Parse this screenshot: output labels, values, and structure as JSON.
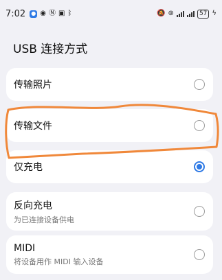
{
  "status_bar": {
    "time": "7:02",
    "battery": "57",
    "icons": [
      "app-icon",
      "eye-icon",
      "nfc-icon",
      "gallery-icon",
      "bluetooth-icon",
      "mute-icon",
      "hotspot-icon",
      "signal-icon",
      "signal-icon",
      "battery-icon",
      "charging-icon"
    ]
  },
  "page": {
    "title": "USB 连接方式"
  },
  "options": [
    {
      "label": "传输照片",
      "selected": false
    },
    {
      "label": "传输文件",
      "selected": false
    },
    {
      "label": "仅充电",
      "selected": true
    },
    {
      "label": "反向充电",
      "subtitle": "为已连接设备供电",
      "selected": false
    },
    {
      "label": "MIDI",
      "subtitle": "将设备用作 MIDI 输入设备",
      "selected": false
    }
  ],
  "colors": {
    "accent": "#2f7ae5",
    "annotation": "#f0883a",
    "background": "#f1f1f6"
  }
}
